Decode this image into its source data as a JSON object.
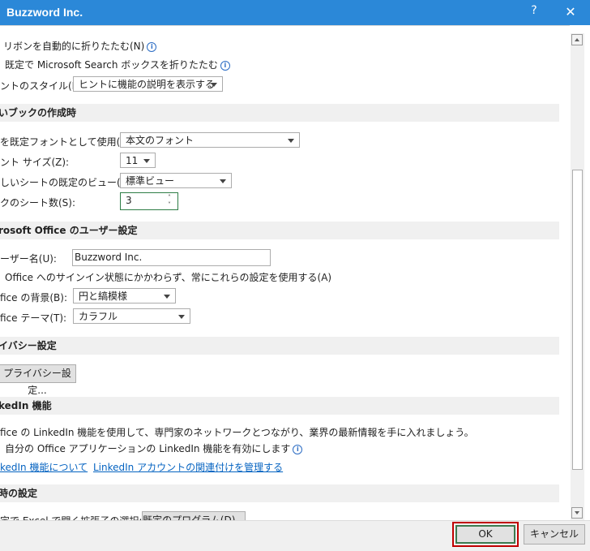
{
  "window": {
    "title": "Buzzword Inc.",
    "help": "?",
    "close": "✕"
  },
  "ribbon": {
    "auto_collapse": "リボンを自動的に折りたたむ(N)",
    "collapse_search": "既定で Microsoft Search ボックスを折りたたむ",
    "tooltip_style_label": "ントのスタイル(R):",
    "tooltip_style_value": "ヒントに機能の説明を表示する"
  },
  "new_workbook": {
    "header": "いブックの作成時",
    "font_label": "を既定フォントとして使用(N):",
    "font_value": "本文のフォント",
    "size_label": "ント サイズ(Z):",
    "size_value": "11",
    "view_label": "しいシートの既定のビュー(V):",
    "view_value": "標準ビュー",
    "sheets_label": "クのシート数(S):",
    "sheets_value": "3"
  },
  "office_user": {
    "header": "rosoft Office のユーザー設定",
    "username_label": "ーザー名(U):",
    "username_value": "Buzzword Inc.",
    "always_use": "Office へのサインイン状態にかかわらず、常にこれらの設定を使用する(A)",
    "background_label": "fice の背景(B):",
    "background_value": "円と縞模様",
    "theme_label": "fice テーマ(T):",
    "theme_value": "カラフル"
  },
  "privacy": {
    "header": "イバシー設定",
    "button": "プライバシー設定..."
  },
  "linkedin": {
    "header": "kedIn 機能",
    "description": "fice の LinkedIn 機能を使用して、専門家のネットワークとつながり、業界の最新情報を手に入れましょう。",
    "enable": "自分の Office アプリケーションの LinkedIn 機能を有効にします",
    "link_about": "kedIn 機能について",
    "link_manage": "LinkedIn アカウントの関連付けを管理する"
  },
  "startup": {
    "header": "時の設定",
    "partial_label": "定で Excel で開く拡張子の選択:",
    "default_programs": "既定のプログラム(D)..."
  },
  "footer": {
    "ok": "OK",
    "cancel": "キャンセル"
  },
  "colors": {
    "titlebar": "#2b88d8",
    "link": "#0563c1",
    "highlight": "#c00000"
  }
}
